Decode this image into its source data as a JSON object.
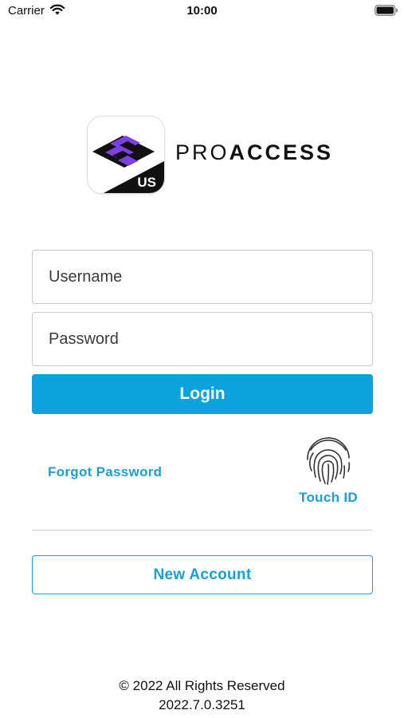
{
  "status_bar": {
    "carrier": "Carrier",
    "time": "10:00",
    "wifi_icon": "wifi-icon",
    "battery_icon": "battery-icon"
  },
  "logo": {
    "brand_light": "PRO",
    "brand_bold": "ACCESS",
    "badge": "US",
    "icon": "proaccess-app-icon",
    "colors": {
      "purple": "#7b3fe4",
      "dark": "#111111"
    }
  },
  "form": {
    "username_placeholder": "Username",
    "username_value": "",
    "password_placeholder": "Password",
    "password_value": "",
    "login_label": "Login"
  },
  "links": {
    "forgot_password": "Forgot Password",
    "touch_id": "Touch ID",
    "touch_id_icon": "fingerprint-icon"
  },
  "new_account_label": "New Account",
  "footer": {
    "copyright": "© 2022 All Rights Reserved",
    "version": "2022.7.0.3251"
  },
  "colors": {
    "accent": "#0ea2dc",
    "link": "#1a9fd6",
    "field_border": "#c8c8c8"
  }
}
